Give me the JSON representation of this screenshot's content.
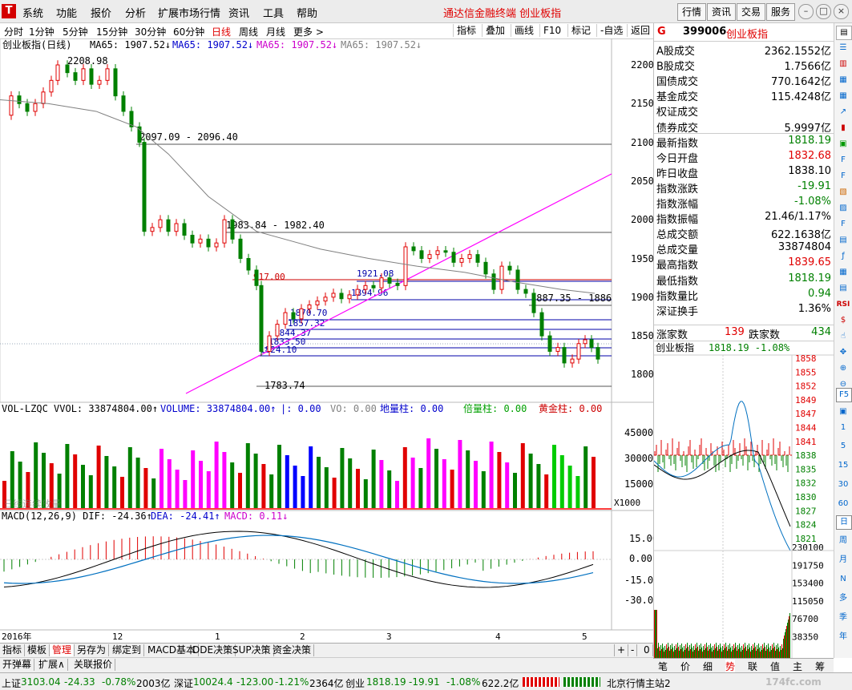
{
  "menu": {
    "items": [
      "系统",
      "功能",
      "报价",
      "分析",
      "扩展市场行情",
      "资讯",
      "工具",
      "帮助"
    ],
    "app_title": "通达信金融终端  创业板指",
    "right_buttons": [
      "行情",
      "资讯",
      "交易",
      "服务"
    ]
  },
  "periods": {
    "items": [
      "分时",
      "1分钟",
      "5分钟",
      "15分钟",
      "30分钟",
      "60分钟",
      "日线",
      "周线",
      "月线",
      "更多 >"
    ],
    "active": "日线",
    "tools": [
      "指标",
      "叠加",
      "画线",
      "F10",
      "标记",
      "-自选",
      "返回"
    ]
  },
  "main_chart": {
    "legend_name": "创业板指(日线)",
    "ma_labels": [
      "MA65: 1907.52↓",
      "MA65: 1907.52↓",
      "MA65: 1907.52↓",
      "MA65: 1907.52↓"
    ],
    "y_ticks": [
      "2200",
      "2150",
      "2100",
      "2050",
      "2000",
      "1950",
      "1900",
      "1850",
      "1800"
    ],
    "annotations": {
      "high": "2208.98",
      "low": "1783.74",
      "level1": "2097.09 - 2096.40",
      "level2": "1983.84 - 1982.40",
      "level3": "1887.35 - 1886",
      "l_917": "917.00",
      "l_1921": "1921.08",
      "l_1894": "1894.96",
      "l_1870": "1870.70",
      "l_1857": "1857.32",
      "l_1844": "1844.37",
      "l_1833": "1833.50",
      "l_1824": "1824.10"
    }
  },
  "volume_panel": {
    "header": "VOL-LZQC VVOL: 33874804.00↑ VOLUME: 33874804.00↑ |: 0.00  VO: 0.00 地量柱: 0.00  倍量柱: 0.00  黄金柱: 0.00",
    "part1": "VOL-LZQC VVOL: 33874804.00↑",
    "part2": "VOLUME: 33874804.00↑",
    "part3": "|: 0.00",
    "part4": "VO: 0.00",
    "part5": "地量柱: 0.00",
    "part6": "倍量柱: 0.00",
    "part7": "黄金柱: 0.00",
    "y_ticks": [
      "45000",
      "30000",
      "15000"
    ],
    "unit": "X1000",
    "watermark": "日线连续放量"
  },
  "macd_panel": {
    "p1": "MACD(12,26,9) DIF: -24.36↑",
    "p2": "DEA: -24.41↑",
    "p3": "MACD: 0.11↓",
    "y_ticks": [
      "15.00",
      "0.00",
      "-15.00",
      "-30.00"
    ]
  },
  "x_axis": {
    "labels": [
      "2016年",
      "12",
      "1",
      "2",
      "3",
      "4",
      "5"
    ]
  },
  "bottom_tabs": [
    "指标",
    "模板",
    "管理",
    "另存为",
    "绑定到",
    "MACD基本",
    "DDE决策",
    "SUP决策",
    "资金决策"
  ],
  "bottom_tabs_active": "管理",
  "bottom_tabs2": [
    "开弹幕",
    "扩展∧",
    "关联报价"
  ],
  "bottom_nav": [
    "+",
    "-",
    "0"
  ],
  "right_panel": {
    "code": "399006",
    "name": "创业板指",
    "rows": [
      {
        "label": "A股成交",
        "value": "2362.1552亿"
      },
      {
        "label": "B股成交",
        "value": "1.7566亿"
      },
      {
        "label": "国债成交",
        "value": "770.1642亿"
      },
      {
        "label": "基金成交",
        "value": "115.4248亿"
      },
      {
        "label": "权证成交",
        "value": ""
      },
      {
        "label": "债券成交",
        "value": "5.9997亿"
      },
      {
        "label": "最新指数",
        "value": "1818.19"
      },
      {
        "label": "今日开盘",
        "value": "1832.68"
      },
      {
        "label": "昨日收盘",
        "value": "1838.10"
      },
      {
        "label": "指数涨跌",
        "value": "-19.91"
      },
      {
        "label": "指数涨幅",
        "value": "-1.08%"
      },
      {
        "label": "指数振幅",
        "value": "21.46/1.17%"
      },
      {
        "label": "总成交额",
        "value": "622.1638亿"
      },
      {
        "label": "总成交量",
        "value": "33874804"
      },
      {
        "label": "最高指数",
        "value": "1839.65"
      },
      {
        "label": "最低指数",
        "value": "1818.19"
      },
      {
        "label": "指数量比",
        "value": "0.94"
      },
      {
        "label": "深证换手",
        "value": "1.36%"
      }
    ],
    "up_label": "涨家数",
    "up_count": "139",
    "down_label": "跌家数",
    "down_count": "434",
    "mini_title": "创业板指",
    "mini_value": "1818.19 -1.08%",
    "mini_y_ticks": [
      "1858",
      "1855",
      "1852",
      "1849",
      "1847",
      "1844",
      "1841",
      "1838",
      "1835",
      "1832",
      "1830",
      "1827",
      "1824",
      "1821"
    ],
    "mini_vol_ticks": [
      "230100",
      "191750",
      "153400",
      "115050",
      "76700",
      "38350"
    ],
    "tabs": [
      "笔",
      "价",
      "细",
      "势",
      "联",
      "值",
      "主",
      "筹"
    ],
    "active_tab": "势"
  },
  "icon_column": [
    "1",
    "5",
    "15",
    "30",
    "60",
    "日",
    "周",
    "月",
    "N",
    "多",
    "季",
    "年"
  ],
  "status": {
    "sh_label": "上证",
    "sh_value": "3103.04",
    "sh_change": "-24.33",
    "sh_pct": "-0.78%",
    "sh_amount": "2003亿",
    "sz_label": "深证",
    "sz_value": "10024.4",
    "sz_change": "-123.00",
    "sz_pct": "-1.21%",
    "sz_amount": "2364亿",
    "cy_label": "创业",
    "cy_value": "1818.19",
    "cy_change": "-19.91",
    "cy_pct": "-1.08%",
    "cy_amount": "622.2亿",
    "server": "北京行情主站2",
    "watermark": "174fc.com"
  },
  "colors": {
    "up": "#e00000",
    "down": "#008000",
    "ma": "#808080",
    "trend": "#ff00ff",
    "blue": "#0000cc"
  }
}
